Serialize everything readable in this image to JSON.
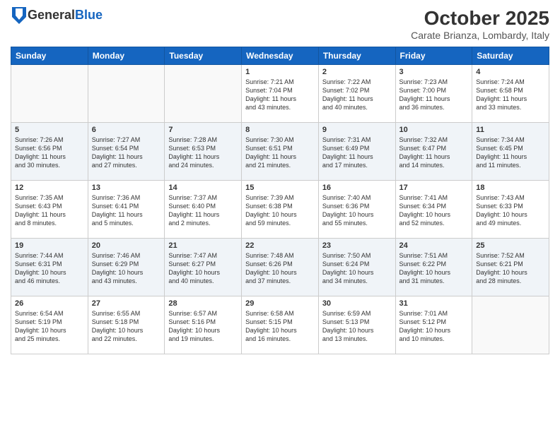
{
  "header": {
    "logo_general": "General",
    "logo_blue": "Blue",
    "month_title": "October 2025",
    "location": "Carate Brianza, Lombardy, Italy"
  },
  "weekdays": [
    "Sunday",
    "Monday",
    "Tuesday",
    "Wednesday",
    "Thursday",
    "Friday",
    "Saturday"
  ],
  "weeks": [
    [
      {
        "day": "",
        "info": ""
      },
      {
        "day": "",
        "info": ""
      },
      {
        "day": "",
        "info": ""
      },
      {
        "day": "1",
        "info": "Sunrise: 7:21 AM\nSunset: 7:04 PM\nDaylight: 11 hours\nand 43 minutes."
      },
      {
        "day": "2",
        "info": "Sunrise: 7:22 AM\nSunset: 7:02 PM\nDaylight: 11 hours\nand 40 minutes."
      },
      {
        "day": "3",
        "info": "Sunrise: 7:23 AM\nSunset: 7:00 PM\nDaylight: 11 hours\nand 36 minutes."
      },
      {
        "day": "4",
        "info": "Sunrise: 7:24 AM\nSunset: 6:58 PM\nDaylight: 11 hours\nand 33 minutes."
      }
    ],
    [
      {
        "day": "5",
        "info": "Sunrise: 7:26 AM\nSunset: 6:56 PM\nDaylight: 11 hours\nand 30 minutes."
      },
      {
        "day": "6",
        "info": "Sunrise: 7:27 AM\nSunset: 6:54 PM\nDaylight: 11 hours\nand 27 minutes."
      },
      {
        "day": "7",
        "info": "Sunrise: 7:28 AM\nSunset: 6:53 PM\nDaylight: 11 hours\nand 24 minutes."
      },
      {
        "day": "8",
        "info": "Sunrise: 7:30 AM\nSunset: 6:51 PM\nDaylight: 11 hours\nand 21 minutes."
      },
      {
        "day": "9",
        "info": "Sunrise: 7:31 AM\nSunset: 6:49 PM\nDaylight: 11 hours\nand 17 minutes."
      },
      {
        "day": "10",
        "info": "Sunrise: 7:32 AM\nSunset: 6:47 PM\nDaylight: 11 hours\nand 14 minutes."
      },
      {
        "day": "11",
        "info": "Sunrise: 7:34 AM\nSunset: 6:45 PM\nDaylight: 11 hours\nand 11 minutes."
      }
    ],
    [
      {
        "day": "12",
        "info": "Sunrise: 7:35 AM\nSunset: 6:43 PM\nDaylight: 11 hours\nand 8 minutes."
      },
      {
        "day": "13",
        "info": "Sunrise: 7:36 AM\nSunset: 6:41 PM\nDaylight: 11 hours\nand 5 minutes."
      },
      {
        "day": "14",
        "info": "Sunrise: 7:37 AM\nSunset: 6:40 PM\nDaylight: 11 hours\nand 2 minutes."
      },
      {
        "day": "15",
        "info": "Sunrise: 7:39 AM\nSunset: 6:38 PM\nDaylight: 10 hours\nand 59 minutes."
      },
      {
        "day": "16",
        "info": "Sunrise: 7:40 AM\nSunset: 6:36 PM\nDaylight: 10 hours\nand 55 minutes."
      },
      {
        "day": "17",
        "info": "Sunrise: 7:41 AM\nSunset: 6:34 PM\nDaylight: 10 hours\nand 52 minutes."
      },
      {
        "day": "18",
        "info": "Sunrise: 7:43 AM\nSunset: 6:33 PM\nDaylight: 10 hours\nand 49 minutes."
      }
    ],
    [
      {
        "day": "19",
        "info": "Sunrise: 7:44 AM\nSunset: 6:31 PM\nDaylight: 10 hours\nand 46 minutes."
      },
      {
        "day": "20",
        "info": "Sunrise: 7:46 AM\nSunset: 6:29 PM\nDaylight: 10 hours\nand 43 minutes."
      },
      {
        "day": "21",
        "info": "Sunrise: 7:47 AM\nSunset: 6:27 PM\nDaylight: 10 hours\nand 40 minutes."
      },
      {
        "day": "22",
        "info": "Sunrise: 7:48 AM\nSunset: 6:26 PM\nDaylight: 10 hours\nand 37 minutes."
      },
      {
        "day": "23",
        "info": "Sunrise: 7:50 AM\nSunset: 6:24 PM\nDaylight: 10 hours\nand 34 minutes."
      },
      {
        "day": "24",
        "info": "Sunrise: 7:51 AM\nSunset: 6:22 PM\nDaylight: 10 hours\nand 31 minutes."
      },
      {
        "day": "25",
        "info": "Sunrise: 7:52 AM\nSunset: 6:21 PM\nDaylight: 10 hours\nand 28 minutes."
      }
    ],
    [
      {
        "day": "26",
        "info": "Sunrise: 6:54 AM\nSunset: 5:19 PM\nDaylight: 10 hours\nand 25 minutes."
      },
      {
        "day": "27",
        "info": "Sunrise: 6:55 AM\nSunset: 5:18 PM\nDaylight: 10 hours\nand 22 minutes."
      },
      {
        "day": "28",
        "info": "Sunrise: 6:57 AM\nSunset: 5:16 PM\nDaylight: 10 hours\nand 19 minutes."
      },
      {
        "day": "29",
        "info": "Sunrise: 6:58 AM\nSunset: 5:15 PM\nDaylight: 10 hours\nand 16 minutes."
      },
      {
        "day": "30",
        "info": "Sunrise: 6:59 AM\nSunset: 5:13 PM\nDaylight: 10 hours\nand 13 minutes."
      },
      {
        "day": "31",
        "info": "Sunrise: 7:01 AM\nSunset: 5:12 PM\nDaylight: 10 hours\nand 10 minutes."
      },
      {
        "day": "",
        "info": ""
      }
    ]
  ]
}
